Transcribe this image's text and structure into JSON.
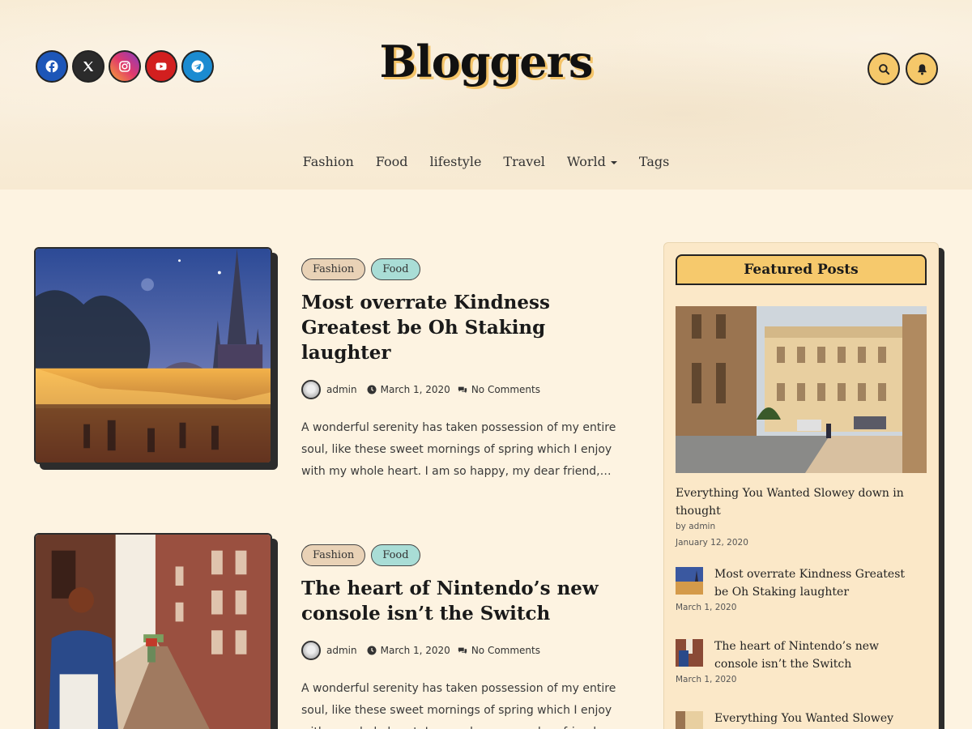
{
  "site": {
    "logo": "Bloggers"
  },
  "social": [
    {
      "name": "facebook",
      "icon": "facebook-icon",
      "color": "#1d56b8"
    },
    {
      "name": "x",
      "icon": "x-icon",
      "color": "#2b2b2b"
    },
    {
      "name": "instagram",
      "icon": "instagram-icon",
      "color": "#e13a6b"
    },
    {
      "name": "youtube",
      "icon": "youtube-icon",
      "color": "#d21f1f"
    },
    {
      "name": "telegram",
      "icon": "telegram-icon",
      "color": "#1b8bd1"
    }
  ],
  "header_icons": {
    "search": "search-icon",
    "notifications": "bell-icon",
    "accent": "#f5c86a"
  },
  "nav": {
    "items": [
      {
        "label": "Fashion"
      },
      {
        "label": "Food"
      },
      {
        "label": "lifestyle"
      },
      {
        "label": "Travel"
      },
      {
        "label": "World",
        "has_dropdown": true
      },
      {
        "label": "Tags"
      }
    ]
  },
  "posts": [
    {
      "categories": [
        "Fashion",
        "Food"
      ],
      "title": "Most overrate Kindness Greatest be Oh Staking laughter",
      "author": "admin",
      "date": "March 1, 2020",
      "comments": "No Comments",
      "excerpt": "A wonderful serenity has taken possession of my entire soul, like these sweet mornings of spring which I enjoy with my whole heart. I am so happy, my dear friend,…"
    },
    {
      "categories": [
        "Fashion",
        "Food"
      ],
      "title": "The heart of Nintendo’s new console isn’t the Switch",
      "author": "admin",
      "date": "March 1, 2020",
      "comments": "No Comments",
      "excerpt": "A wonderful serenity has taken possession of my entire soul, like these sweet mornings of spring which I enjoy with my whole heart. I am so happy, my dear friend,…"
    }
  ],
  "sidebar": {
    "featured_title": "Featured Posts",
    "featured": {
      "title": "Everything You Wanted Slowey down in thought",
      "byline": "by admin",
      "date": "January 12, 2020"
    },
    "list": [
      {
        "title": "Most overrate Kindness Greatest be Oh Staking laughter",
        "date": "March 1, 2020"
      },
      {
        "title": "The heart of Nintendo’s new console isn’t the Switch",
        "date": "March 1, 2020"
      },
      {
        "title": "Everything You Wanted Slowey down",
        "date": ""
      }
    ]
  }
}
